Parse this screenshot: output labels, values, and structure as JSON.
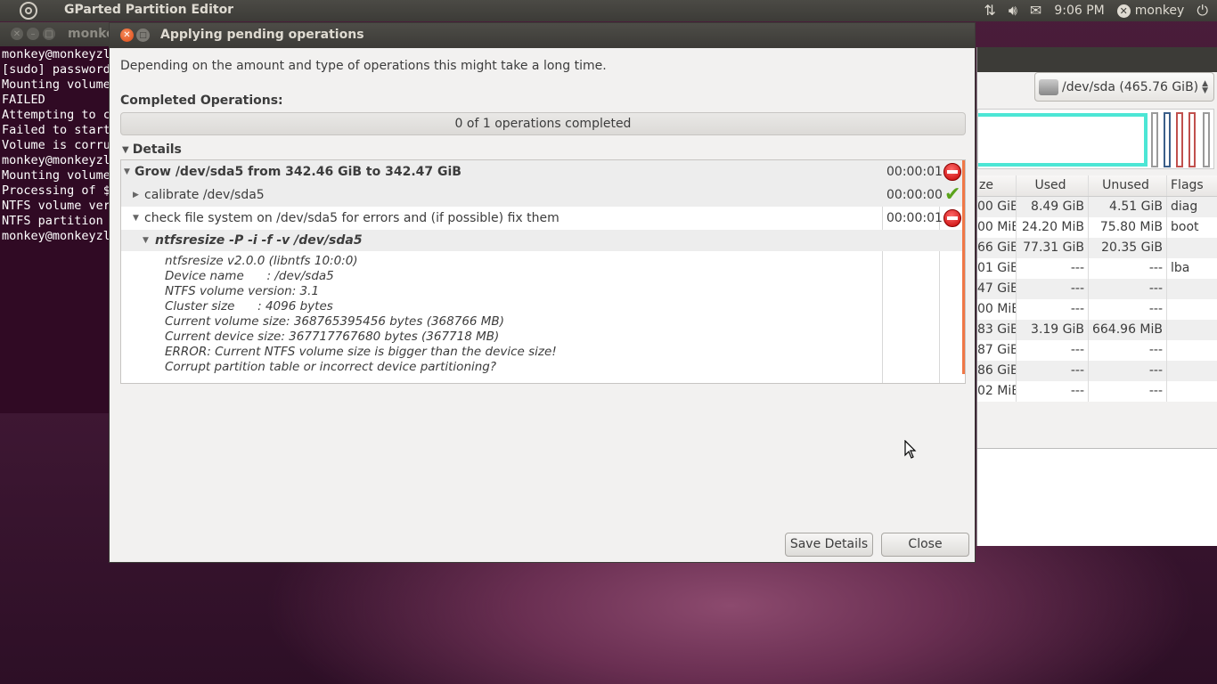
{
  "panel": {
    "app_title": "GParted Partition Editor",
    "clock": "9:06 PM",
    "user": "monkey"
  },
  "terminal": {
    "title": "monke",
    "lines": [
      "monkey@monkeyzl",
      "[sudo] password",
      "Mounting volume",
      "FAILED",
      "Attempting to c",
      "Failed to start",
      "Volume is corru",
      "monkey@monkeyzl",
      "Mounting volume",
      "Processing of $",
      "NTFS volume ver",
      "NTFS partition",
      "monkey@monkeyzl"
    ]
  },
  "gparted": {
    "device": "/dev/sda  (465.76 GiB)",
    "columns": {
      "size": "ze",
      "used": "Used",
      "unused": "Unused",
      "flags": "Flags"
    },
    "rows": [
      {
        "size": "00 GiB",
        "used": "8.49 GiB",
        "unused": "4.51 GiB",
        "flags": "diag"
      },
      {
        "size": "00 MiB",
        "used": "24.20 MiB",
        "unused": "75.80 MiB",
        "flags": "boot"
      },
      {
        "size": "66 GiB",
        "used": "77.31 GiB",
        "unused": "20.35 GiB",
        "flags": ""
      },
      {
        "size": "01 GiB",
        "used": "---",
        "unused": "---",
        "flags": "lba"
      },
      {
        "size": "47 GiB",
        "used": "---",
        "unused": "---",
        "flags": ""
      },
      {
        "size": "00 MiB",
        "used": "---",
        "unused": "---",
        "flags": ""
      },
      {
        "size": "83 GiB",
        "used": "3.19 GiB",
        "unused": "664.96 MiB",
        "flags": ""
      },
      {
        "size": "87 GiB",
        "used": "---",
        "unused": "---",
        "flags": ""
      },
      {
        "size": "86 GiB",
        "used": "---",
        "unused": "---",
        "flags": ""
      },
      {
        "size": "02 MiB",
        "used": "---",
        "unused": "---",
        "flags": ""
      }
    ]
  },
  "dialog": {
    "title": "Applying pending operations",
    "description": "Depending on the amount and type of operations this might take a long time.",
    "completed_label": "Completed Operations:",
    "progress_text": "0 of 1 operations completed",
    "progress_fraction": 0,
    "details_label": "Details",
    "tree": [
      {
        "label": "Grow /dev/sda5 from 342.46 GiB to 342.47 GiB",
        "time": "00:00:01",
        "status": "error"
      },
      {
        "label": "calibrate /dev/sda5",
        "time": "00:00:00",
        "status": "success"
      },
      {
        "label": "check file system on /dev/sda5 for errors and (if possible) fix them",
        "time": "00:00:01",
        "status": "error"
      },
      {
        "label": "ntfsresize -P -i -f -v /dev/sda5",
        "time": "",
        "status": ""
      }
    ],
    "log_lines": [
      "ntfsresize v2.0.0 (libntfs 10:0:0)",
      "Device name      : /dev/sda5",
      "NTFS volume version: 3.1",
      "Cluster size      : 4096 bytes",
      "Current volume size: 368765395456 bytes (368766 MB)",
      "Current device size: 367717767680 bytes (367718 MB)",
      "ERROR: Current NTFS volume size is bigger than the device size!",
      "Corrupt partition table or incorrect device partitioning?"
    ],
    "save_details_label": "Save Details",
    "close_label": "Close"
  },
  "colors": {
    "desktop": "#3e1733",
    "terminal_bg": "#300a24",
    "close_button": "#df4a16",
    "error": "#c40000",
    "success": "#5aa31b",
    "partition_ntfs": "#4ce6d5"
  }
}
